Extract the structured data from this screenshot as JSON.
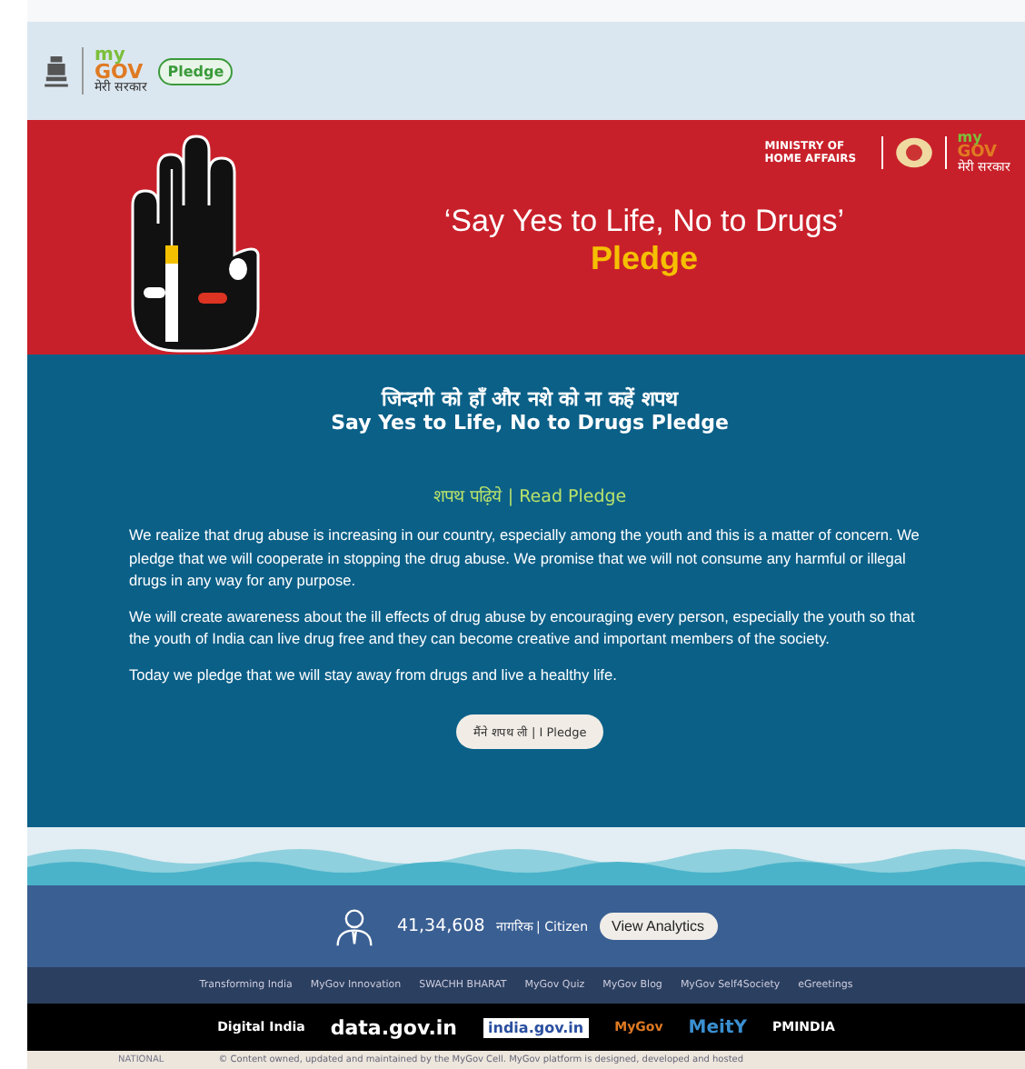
{
  "header": {
    "logo_top": "my",
    "logo_bottom": "GOV",
    "logo_tagline": "मेरी सरकार",
    "pledge_badge": "Pledge"
  },
  "banner": {
    "ministry": "MINISTRY OF HOME AFFAIRS",
    "partner_logo_top": "my",
    "partner_logo_bottom": "GOV",
    "partner_tagline": "मेरी सरकार",
    "title": "‘Say Yes to Life, No to Drugs’",
    "subtitle": "Pledge"
  },
  "pledge": {
    "title_hindi": "जिन्दगी को हाँ और नशे को ना कहें शपथ",
    "title": "Say Yes to Life, No to Drugs Pledge",
    "read_link": "शपथ पढ़िये | Read Pledge",
    "paragraphs": [
      "We realize that drug abuse is increasing in our country, especially among the youth and this is a matter of concern. We pledge that we will cooperate in stopping the drug abuse. We promise that we will not consume any harmful or illegal drugs in any way for any purpose.",
      "We will create awareness about the ill effects of drug abuse by encouraging every person, especially the youth so that the youth of India can live drug free and they can become creative and important members of the society.",
      "Today we pledge that we will stay away from drugs and live a healthy life."
    ],
    "button": "मैंने शपथ ली | I Pledge"
  },
  "stats": {
    "count": "41,34,608",
    "label": "नागरिक | Citizen",
    "button": "View Analytics"
  },
  "footer_links": [
    "Transforming India",
    "MyGov Innovation",
    "SWACHH BHARAT",
    "MyGov Quiz",
    "MyGov Blog",
    "MyGov Self4Society",
    "eGreetings"
  ],
  "partner_logos": [
    "Digital India",
    "data.gov.in",
    "india.gov.in",
    "MyGov",
    "MeitY",
    "PMINDIA"
  ],
  "bottom": {
    "org": "NATIONAL",
    "notice": "© Content owned, updated and maintained by the MyGov Cell. MyGov platform is designed, developed and hosted"
  }
}
